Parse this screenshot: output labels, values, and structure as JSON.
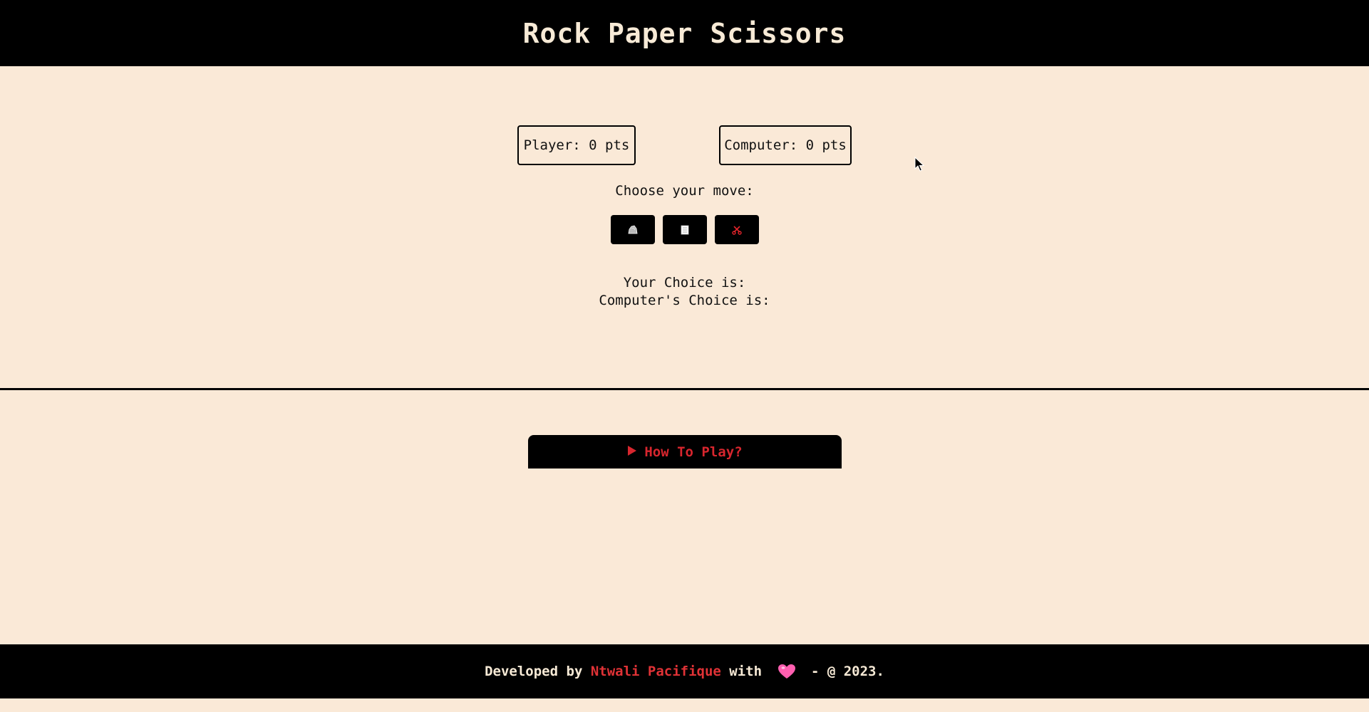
{
  "header": {
    "title": "Rock Paper Scissors"
  },
  "scores": {
    "player": "Player: 0 pts",
    "computer": "Computer: 0 pts"
  },
  "game": {
    "choose_label": "Choose your move:",
    "moves": [
      {
        "name": "rock",
        "icon": "rock-icon"
      },
      {
        "name": "paper",
        "icon": "paper-icon"
      },
      {
        "name": "scissors",
        "icon": "scissors-icon"
      }
    ],
    "your_choice": "Your Choice is:",
    "computer_choice": "Computer's Choice is:"
  },
  "howto": {
    "label": "How To Play?",
    "icon": "play-triangle-icon"
  },
  "footer": {
    "prefix": "Developed by ",
    "author": "Ntwali Pacifique",
    "middle": " with ",
    "suffix": " - @ 2023.",
    "heart_icon": "heart-icon"
  },
  "colors": {
    "background": "#fae9d7",
    "bar": "#000000",
    "accent_red": "#d8262e",
    "title_text": "#f7ead6",
    "heart": "#ff5fb0"
  }
}
